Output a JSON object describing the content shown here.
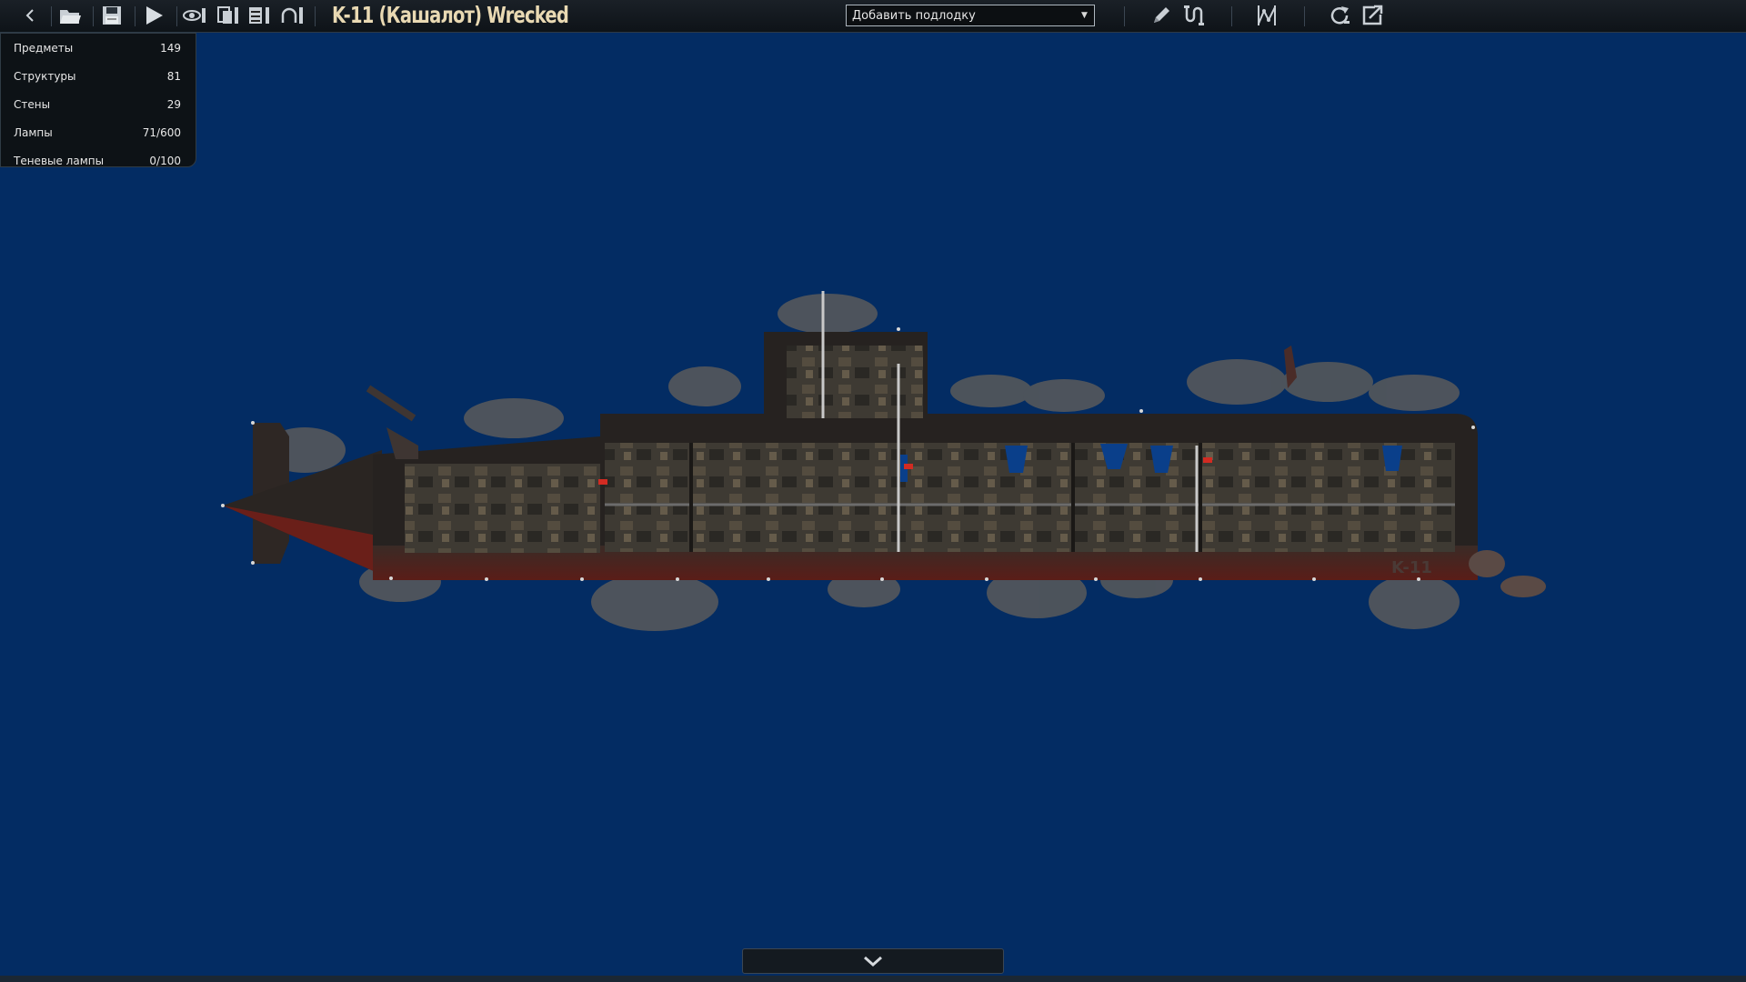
{
  "window": {
    "title": "K-11 (Кашалот) Wrecked"
  },
  "toolbar": {
    "buttons": [
      {
        "name": "back",
        "icon": "chevron-left-icon"
      },
      {
        "name": "open",
        "icon": "folder-icon"
      },
      {
        "name": "save",
        "icon": "floppy-disk-icon"
      },
      {
        "name": "test",
        "icon": "play-icon"
      },
      {
        "name": "visibility",
        "icon": "eye-icon"
      },
      {
        "name": "layers",
        "icon": "layers-icon"
      },
      {
        "name": "entity-list",
        "icon": "list-icon"
      },
      {
        "name": "undo",
        "icon": "undo-icon"
      },
      {
        "name": "draw",
        "icon": "pencil-icon"
      },
      {
        "name": "wiring",
        "icon": "wire-icon"
      },
      {
        "name": "waypoints",
        "icon": "waypoint-graph-icon"
      },
      {
        "name": "rotate",
        "icon": "rotate-icon"
      },
      {
        "name": "export",
        "icon": "export-icon"
      }
    ],
    "dropdown": {
      "selected": "Добавить подлодку"
    }
  },
  "stats": [
    {
      "label": "Предметы",
      "value": "149"
    },
    {
      "label": "Структуры",
      "value": "81"
    },
    {
      "label": "Стены",
      "value": "29"
    },
    {
      "label": "Лампы",
      "value": "71/600"
    },
    {
      "label": "Теневые лампы",
      "value": "0/100"
    }
  ],
  "submarine_label": "K-11",
  "bottom": {
    "toggle_icon": "chevron-down-icon"
  },
  "colors": {
    "background": "#032c63",
    "toolbar": "#12181e",
    "title": "#e9d9b3",
    "hull": "#2a2522",
    "hull_red": "#5a1d18"
  }
}
